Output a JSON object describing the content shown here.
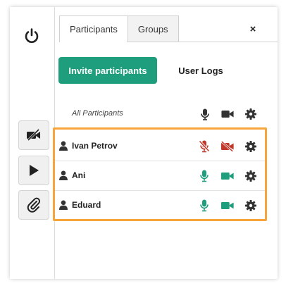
{
  "tabs": [
    {
      "label": "Participants",
      "active": true
    },
    {
      "label": "Groups",
      "active": false
    }
  ],
  "close_label": "×",
  "actions": {
    "invite_label": "Invite participants",
    "userlogs_label": "User Logs"
  },
  "list_header": {
    "label": "All Participants"
  },
  "participants": [
    {
      "name": "Ivan Petrov",
      "mic": "muted",
      "camera": "off"
    },
    {
      "name": "Ani",
      "mic": "on",
      "camera": "on"
    },
    {
      "name": "Eduard",
      "mic": "on",
      "camera": "on"
    }
  ],
  "colors": {
    "accent": "#1f9e7d",
    "muted": "#c0392b",
    "highlight": "#f7a43b",
    "icon_dark": "#333333"
  }
}
